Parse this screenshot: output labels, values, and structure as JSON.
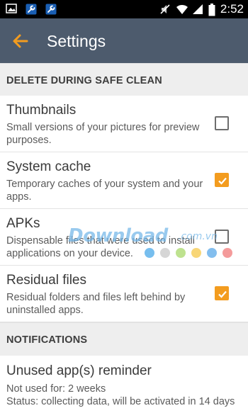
{
  "status_bar": {
    "time": "2:52",
    "icons": [
      "image-icon",
      "wrench-icon",
      "wrench-icon",
      "mute-icon",
      "wifi-icon",
      "signal-icon",
      "battery-icon"
    ]
  },
  "app_bar": {
    "title": "Settings",
    "back_icon": "arrow-left-icon",
    "accent": "#f39c1f",
    "bg": "#4d5b6d"
  },
  "sections": {
    "safe_clean": {
      "header": "DELETE DURING SAFE CLEAN",
      "items": [
        {
          "title": "Thumbnails",
          "desc": "Small versions of your pictures for preview purposes.",
          "checked": false
        },
        {
          "title": "System cache",
          "desc": "Temporary caches of your system and your apps.",
          "checked": true
        },
        {
          "title": "APKs",
          "desc": "Dispensable files that were used to install applications on your device.",
          "checked": false
        },
        {
          "title": "Residual files",
          "desc": "Residual folders and files left behind by uninstalled apps.",
          "checked": true
        }
      ]
    },
    "notifications": {
      "header": "NOTIFICATIONS",
      "reminder": {
        "title": "Unused app(s) reminder",
        "line1": "Not used for: 2 weeks",
        "line2": "Status: collecting data, will be activated in 14 days"
      }
    }
  },
  "watermark": {
    "text": "Download",
    "suffix": ".com.vn",
    "dot_colors": [
      "#4aa8e8",
      "#c8c8c8",
      "#a8d86a",
      "#f5c84a",
      "#5aa8e8",
      "#f07a7a"
    ]
  }
}
